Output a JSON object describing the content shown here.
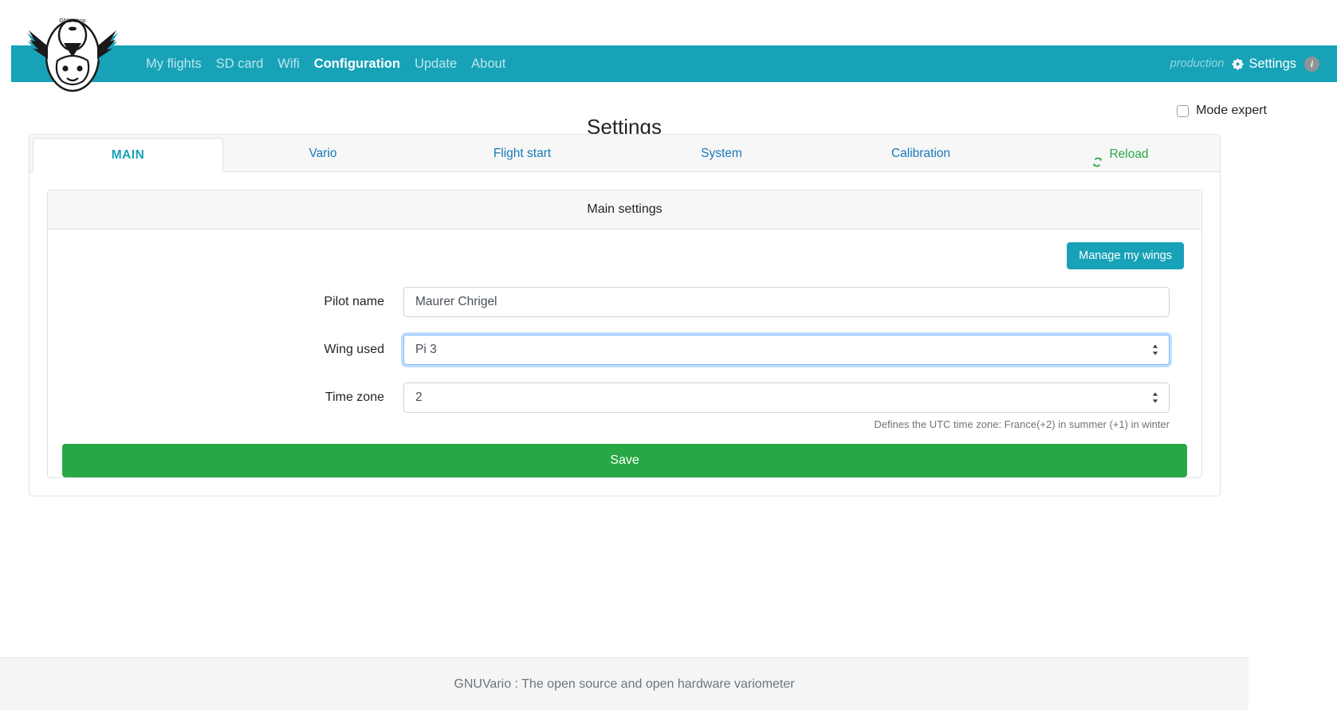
{
  "brand": {
    "logo_alt": "GNU Vario logo",
    "accent_teal": "#17a2b8",
    "accent_green": "#28a745",
    "link_blue": "#1779ba"
  },
  "navbar": {
    "links": [
      {
        "label": "My flights",
        "active": false
      },
      {
        "label": "SD card",
        "active": false
      },
      {
        "label": "Wifi",
        "active": false
      },
      {
        "label": "Configuration",
        "active": true
      },
      {
        "label": "Update",
        "active": false
      },
      {
        "label": "About",
        "active": false
      }
    ],
    "environment": "production",
    "settings_label": "Settings",
    "info_badge": "i"
  },
  "header": {
    "title": "Settings",
    "mode_expert_label": "Mode expert",
    "mode_expert_checked": false
  },
  "tabs": [
    {
      "label": "MAIN",
      "active": true
    },
    {
      "label": "Vario",
      "active": false
    },
    {
      "label": "Flight start",
      "active": false
    },
    {
      "label": "System",
      "active": false
    },
    {
      "label": "Calibration",
      "active": false
    },
    {
      "label": "Reload",
      "active": false,
      "icon": "reload-icon"
    }
  ],
  "panel": {
    "title": "Main settings",
    "manage_wings_label": "Manage my wings",
    "fields": [
      {
        "label": "Pilot name",
        "value": "Maurer Chrigel",
        "type": "text",
        "focused": false
      },
      {
        "label": "Wing used",
        "value": "Pi 3",
        "type": "select",
        "focused": true
      },
      {
        "label": "Time zone",
        "value": "2",
        "type": "select",
        "focused": false,
        "help": "Defines the UTC time zone: France(+2) in summer (+1) in winter"
      }
    ],
    "save_label": "Save"
  },
  "footer": {
    "text": "GNUVario : The open source and open hardware variometer"
  }
}
